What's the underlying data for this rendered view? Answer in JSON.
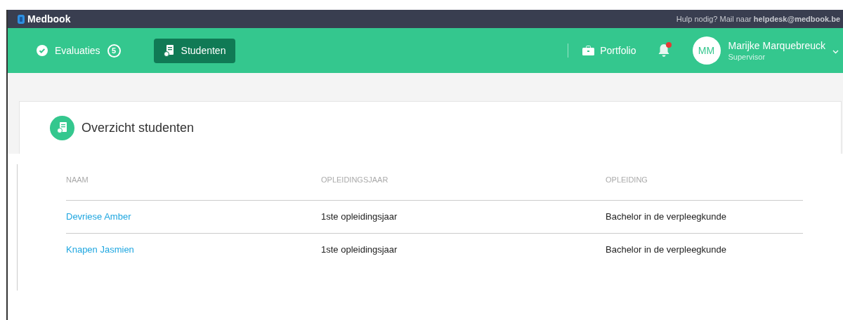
{
  "topbar": {
    "logo": "Medbook",
    "help_text": "Hulp nodig? Mail naar **helpdesk@medbook.be**"
  },
  "nav": {
    "items": [
      {
        "label": "Evaluaties",
        "count": "5",
        "kind": "check",
        "selected": false
      },
      {
        "label": "Studenten",
        "kind": "students",
        "selected": true
      }
    ],
    "portfolio": "Portfolio",
    "notification": true,
    "user": {
      "initials": "MM",
      "name": "Marijke Marquebreuck",
      "role": "Supervisor"
    }
  },
  "page": {
    "title": "Overzicht studenten"
  },
  "table": {
    "columns": [
      "NAAM",
      "OPLEIDINGSJAAR",
      "OPLEIDING"
    ],
    "rows": [
      [
        "Devriese Amber",
        "1ste opleidingsjaar",
        "Bachelor in de verpleegkunde"
      ],
      [
        "Knapen Jasmien",
        "1ste opleidingsjaar",
        "Bachelor in de verpleegkunde"
      ]
    ]
  }
}
